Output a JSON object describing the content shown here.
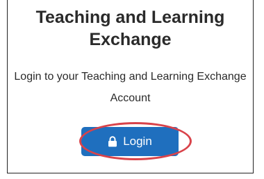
{
  "card": {
    "title": "Teaching and Learning Exchange",
    "subtitle": "Login to your Teaching and Learning Exchange Account"
  },
  "login_button": {
    "label": "Login",
    "icon": "lock-icon",
    "color": "#1f6fbe"
  },
  "annotation": {
    "color": "#d9434a"
  }
}
